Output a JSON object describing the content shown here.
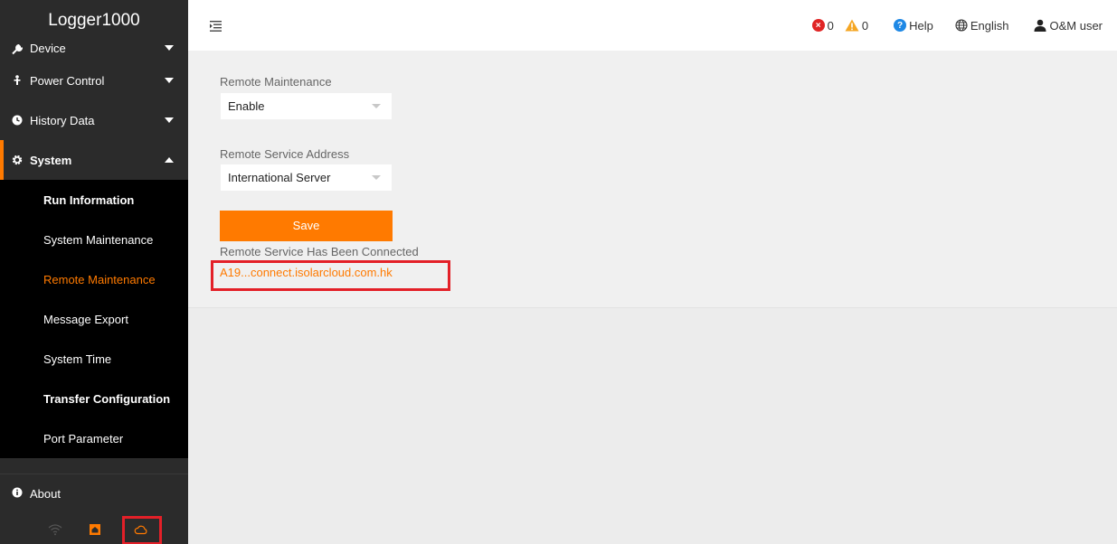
{
  "app": {
    "title": "Logger1000"
  },
  "sidebar": {
    "items": [
      {
        "label": "Device",
        "icon": "wrench-icon"
      },
      {
        "label": "Power Control",
        "icon": "power-control-icon"
      },
      {
        "label": "History Data",
        "icon": "clock-icon"
      },
      {
        "label": "System",
        "icon": "gear-icon"
      }
    ],
    "system_sub": [
      "Run Information",
      "System Maintenance",
      "Remote Maintenance",
      "Message Export",
      "System Time",
      "Transfer Configuration",
      "Port Parameter"
    ],
    "about": {
      "label": "About",
      "icon": "info-icon"
    },
    "status_icons": [
      "wifi-icon",
      "home-icon",
      "cloud-icon"
    ]
  },
  "header": {
    "error_count": "0",
    "warning_count": "0",
    "help_label": "Help",
    "language_label": "English",
    "user_label": "O&M user"
  },
  "main": {
    "remote_maintenance_label": "Remote Maintenance",
    "remote_maintenance_value": "Enable",
    "remote_service_address_label": "Remote Service Address",
    "remote_service_address_value": "International Server",
    "save_label": "Save",
    "status_text": "Remote Service Has Been Connected",
    "connection_address": "A19...connect.isolarcloud.com.hk"
  },
  "colors": {
    "accent": "#ff7a00",
    "sidebar_bg": "#2b2b2b",
    "submenu_bg": "#000000",
    "error": "#e02424",
    "warning": "#f5a623",
    "help": "#1e88e5",
    "highlight_box": "#e32028"
  }
}
